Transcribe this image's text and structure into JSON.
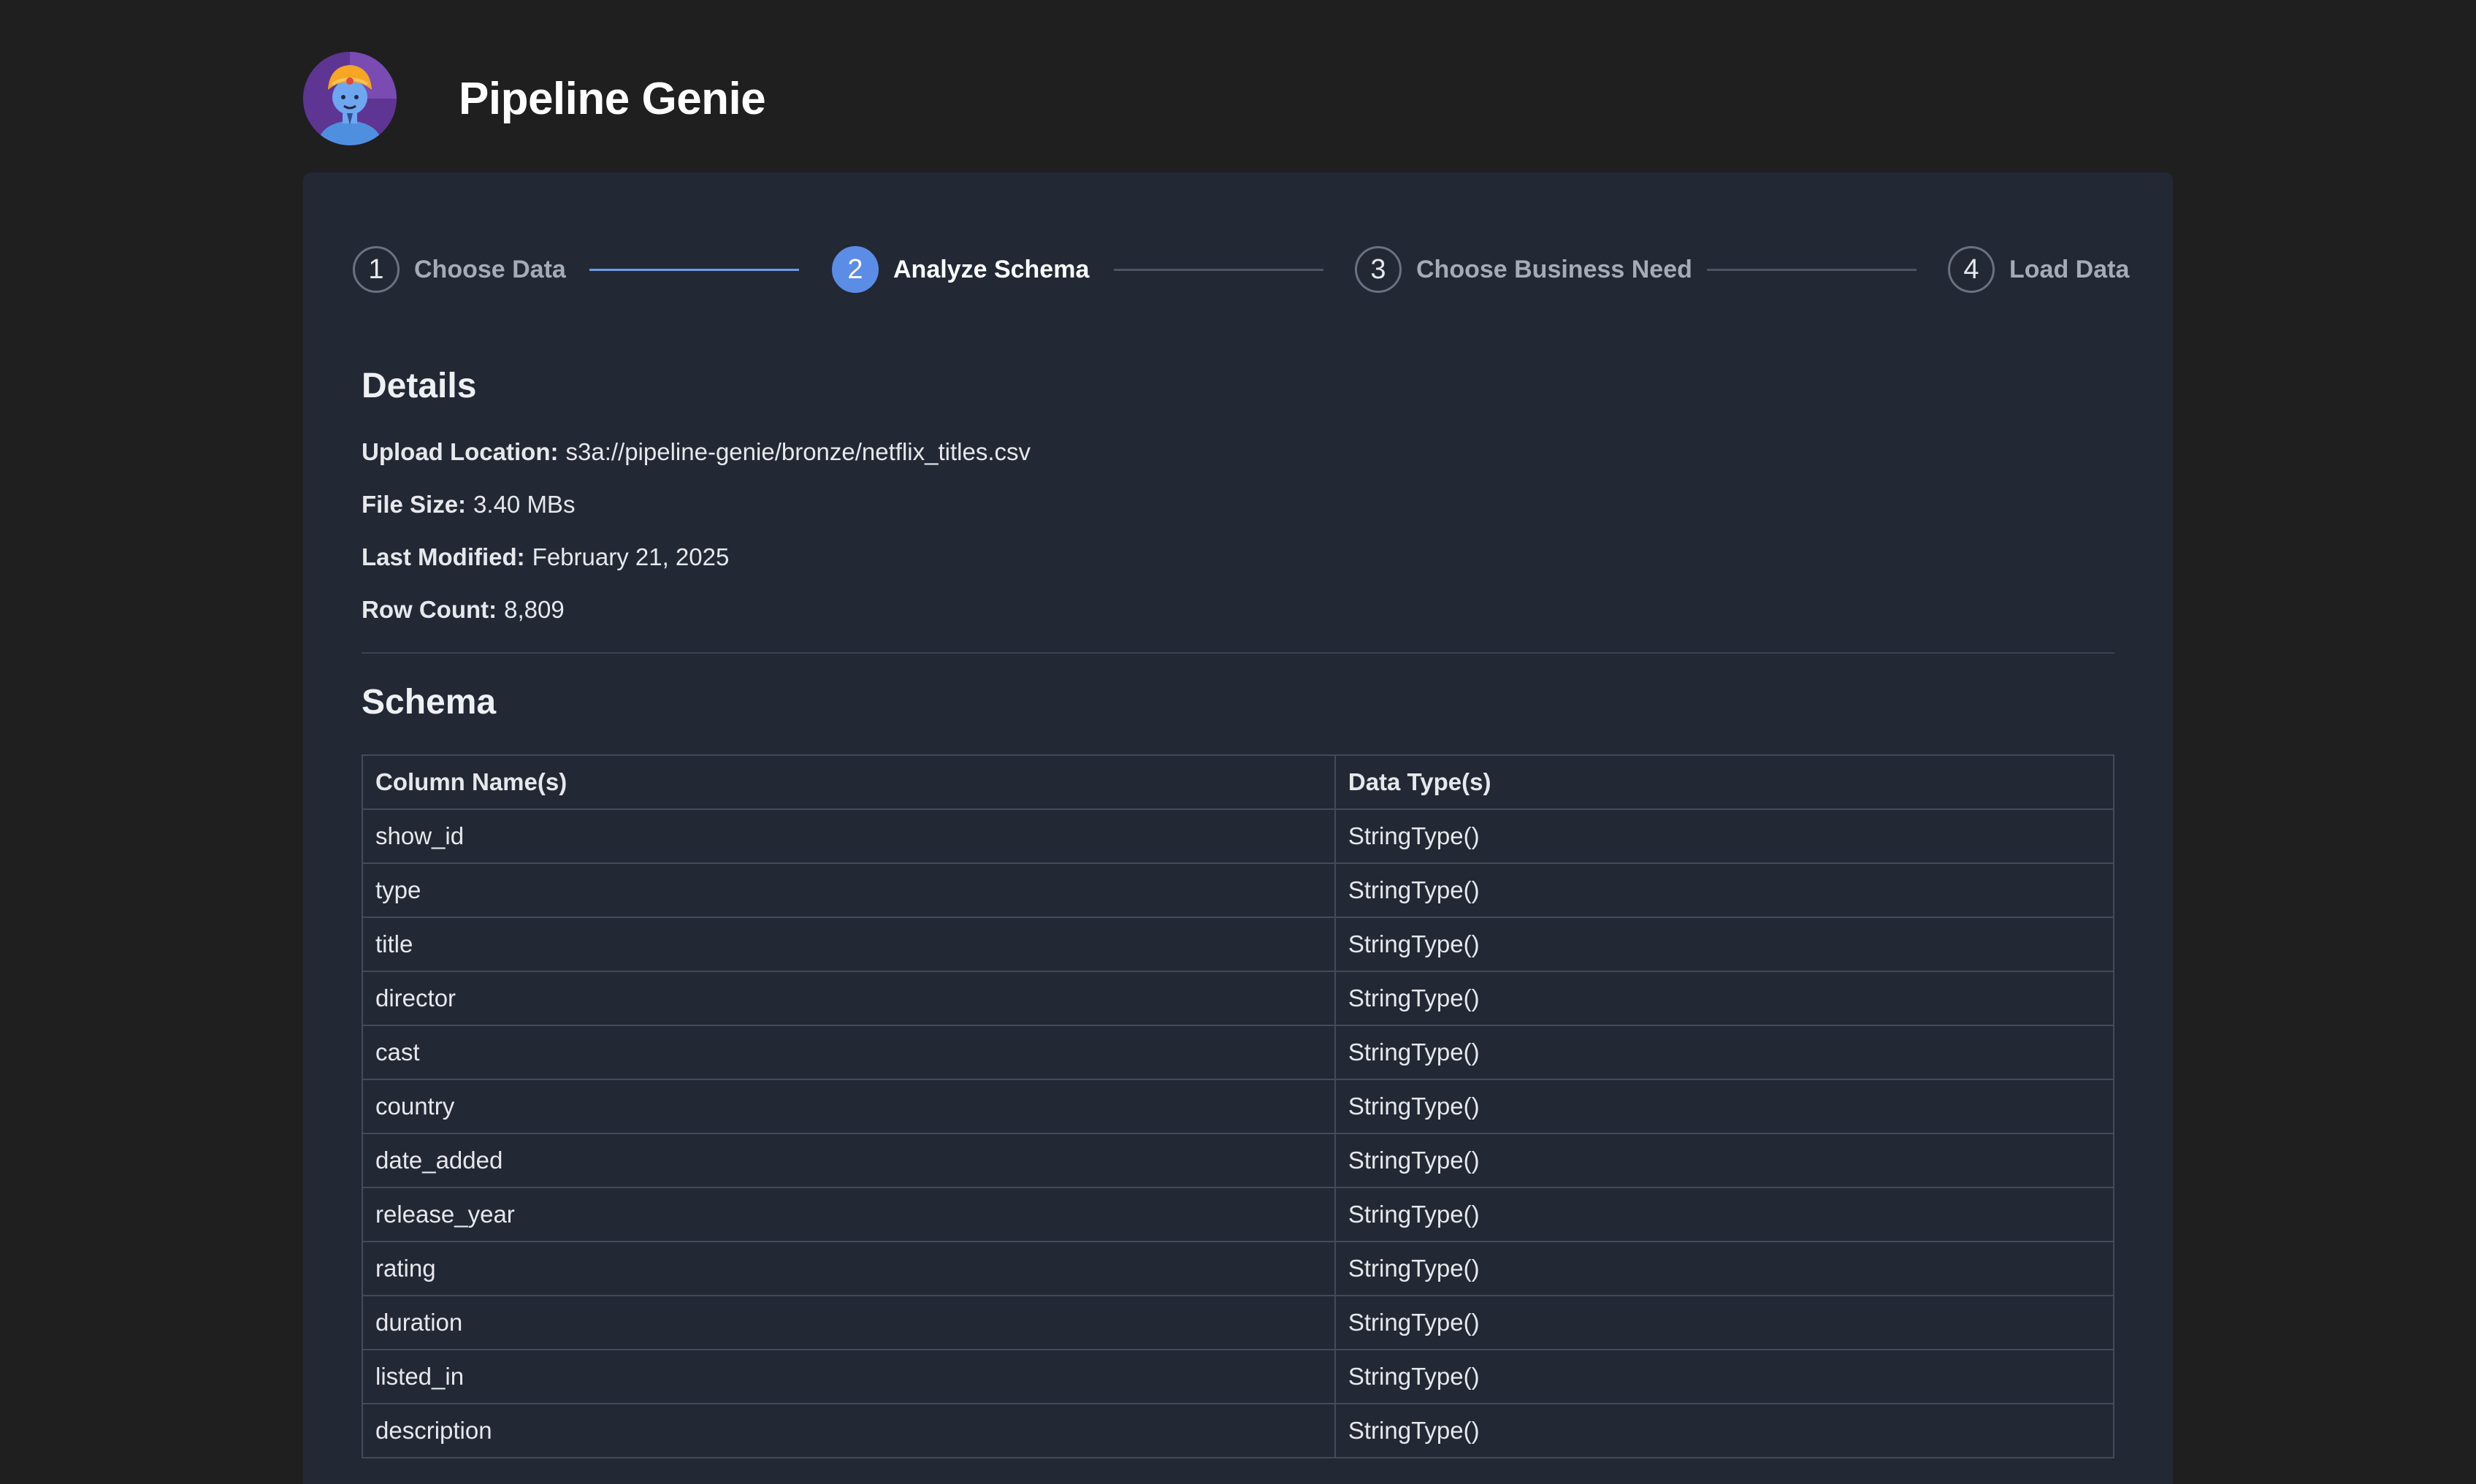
{
  "app": {
    "title": "Pipeline Genie",
    "avatar_icon": "genie-avatar-icon"
  },
  "stepper": {
    "steps": [
      {
        "number": "1",
        "label": "Choose Data",
        "state": "completed"
      },
      {
        "number": "2",
        "label": "Analyze Schema",
        "state": "active"
      },
      {
        "number": "3",
        "label": "Choose Business Need",
        "state": "pending"
      },
      {
        "number": "4",
        "label": "Load Data",
        "state": "pending"
      }
    ]
  },
  "details": {
    "heading": "Details",
    "upload_location_label": "Upload Location:",
    "upload_location": "s3a://pipeline-genie/bronze/netflix_titles.csv",
    "file_size_label": "File Size:",
    "file_size": "3.40 MBs",
    "last_modified_label": "Last Modified:",
    "last_modified": "February 21, 2025",
    "row_count_label": "Row Count:",
    "row_count": "8,809"
  },
  "schema": {
    "heading": "Schema",
    "columns": [
      "Column Name(s)",
      "Data Type(s)"
    ],
    "rows": [
      {
        "name": "show_id",
        "type": "StringType()"
      },
      {
        "name": "type",
        "type": "StringType()"
      },
      {
        "name": "title",
        "type": "StringType()"
      },
      {
        "name": "director",
        "type": "StringType()"
      },
      {
        "name": "cast",
        "type": "StringType()"
      },
      {
        "name": "country",
        "type": "StringType()"
      },
      {
        "name": "date_added",
        "type": "StringType()"
      },
      {
        "name": "release_year",
        "type": "StringType()"
      },
      {
        "name": "rating",
        "type": "StringType()"
      },
      {
        "name": "duration",
        "type": "StringType()"
      },
      {
        "name": "listed_in",
        "type": "StringType()"
      },
      {
        "name": "description",
        "type": "StringType()"
      }
    ]
  },
  "colors": {
    "page_bg": "#1f1f1f",
    "card_bg": "#232835",
    "accent": "#5b8de6",
    "border": "#444a58"
  }
}
